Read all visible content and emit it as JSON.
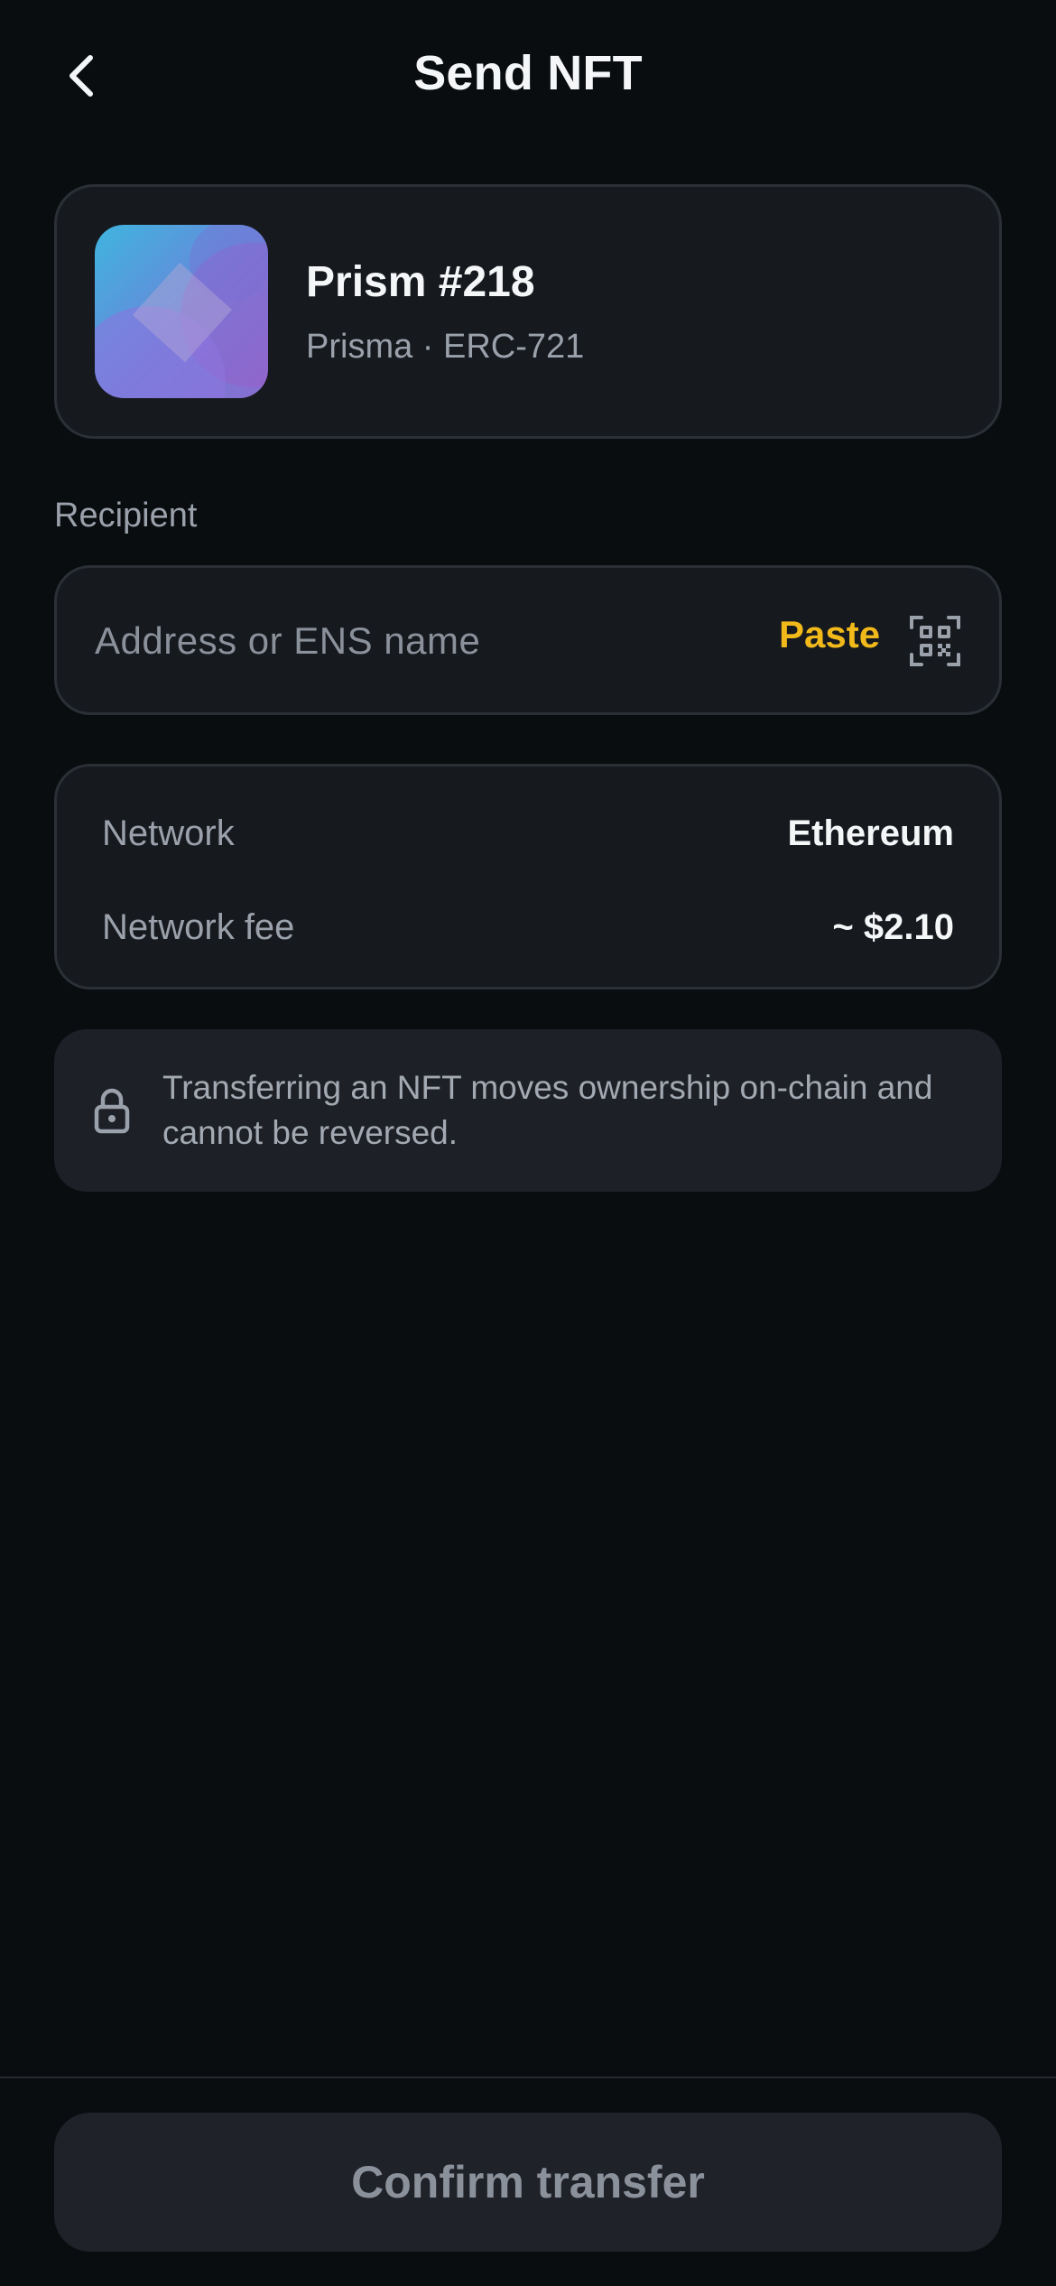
{
  "header": {
    "title": "Send NFT",
    "back_icon": "chevron-left-icon"
  },
  "nft": {
    "name": "Prism #218",
    "subtitle": "Prisma · ERC-721"
  },
  "recipient": {
    "label": "Recipient",
    "value": "",
    "placeholder": "Address or ENS name",
    "paste_label": "Paste",
    "qr_icon": "qr-scan-icon"
  },
  "details": {
    "network_label": "Network",
    "network_value": "Ethereum",
    "fee_label": "Network fee",
    "fee_value": "~ $2.10"
  },
  "notice": {
    "icon": "lock-icon",
    "text": "Transferring an NFT moves ownership on-chain and cannot be reversed."
  },
  "footer": {
    "confirm_label": "Confirm transfer"
  },
  "colors": {
    "background": "#0a0d10",
    "card": "#16191e",
    "accent": "#f2b91a",
    "muted_text": "#9aa1ab",
    "button_disabled": "#1f2229"
  }
}
